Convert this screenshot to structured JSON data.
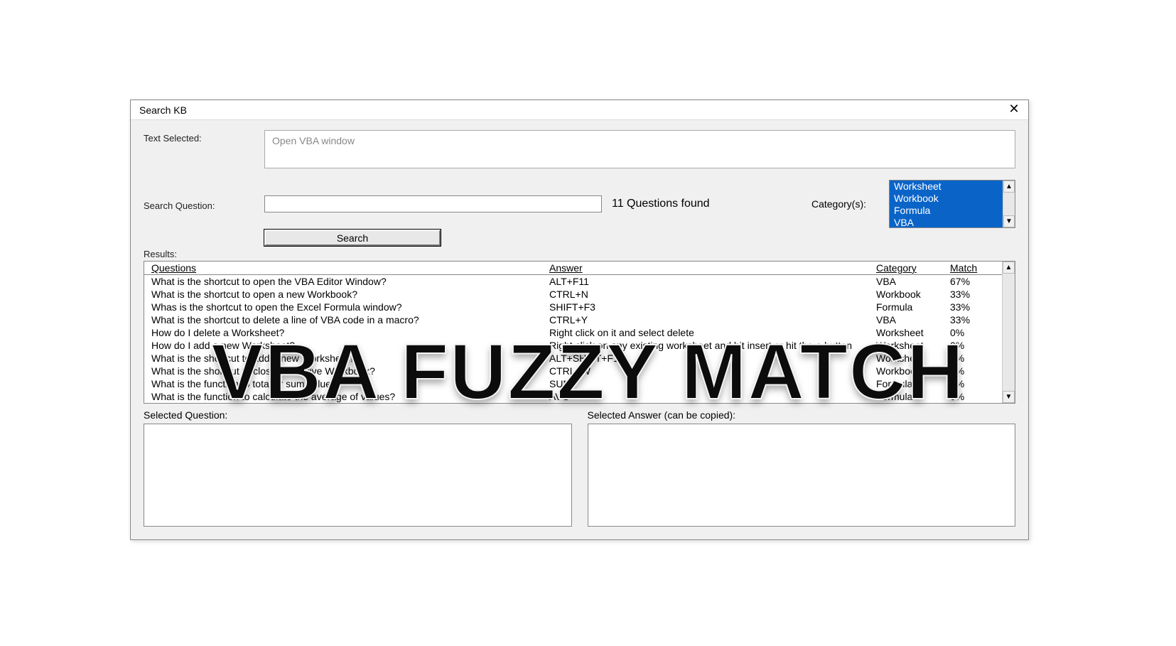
{
  "window": {
    "title": "Search KB"
  },
  "labels": {
    "text_selected": "Text Selected:",
    "search_question": "Search Question:",
    "found": "11 Questions found",
    "categories": "Category(s):",
    "search_btn": "Search",
    "results": "Results:",
    "selected_question": "Selected Question:",
    "selected_answer": "Selected Answer (can be copied):"
  },
  "text_selected_value": "Open VBA window",
  "categories": [
    "Worksheet",
    "Workbook",
    "Formula",
    "VBA"
  ],
  "results_header": {
    "q": "Questions",
    "a": "Answer",
    "c": "Category",
    "m": "Match"
  },
  "results": [
    {
      "q": "What is the shortcut to open the VBA Editor Window?",
      "a": "ALT+F11",
      "c": "VBA",
      "m": "67%"
    },
    {
      "q": "What is the shortcut to open a new Workbook?",
      "a": "CTRL+N",
      "c": "Workbook",
      "m": "33%"
    },
    {
      "q": "Whas is the shortcut to open the Excel Formula window?",
      "a": "SHIFT+F3",
      "c": "Formula",
      "m": "33%"
    },
    {
      "q": "What is the shortcut to delete a line of VBA code in a macro?",
      "a": "CTRL+Y",
      "c": "VBA",
      "m": "33%"
    },
    {
      "q": "How do I delete a Worksheet?",
      "a": "Right click on it and select delete",
      "c": "Worksheet",
      "m": "0%"
    },
    {
      "q": "How do I add a new Worksheet?",
      "a": "Right click on any existing worksheet and hit insert or hit the + button",
      "c": "Worksheet",
      "m": "0%"
    },
    {
      "q": "What is the shortcut to add a new Worksheet?",
      "a": "ALT+SHIFT+F1",
      "c": "Worksheet",
      "m": "0%"
    },
    {
      "q": "What is the shortcut to close the Active Workbook?",
      "a": "CTRL+W",
      "c": "Workbook",
      "m": "0%"
    },
    {
      "q": "What is the function to total or sum values?",
      "a": "SUM",
      "c": "Formula",
      "m": "0%"
    },
    {
      "q": "What is the function to calculate the average of values?",
      "a": "AVG",
      "c": "Formula",
      "m": "0%"
    }
  ],
  "overlay": "VBA FUZZY MATCH"
}
